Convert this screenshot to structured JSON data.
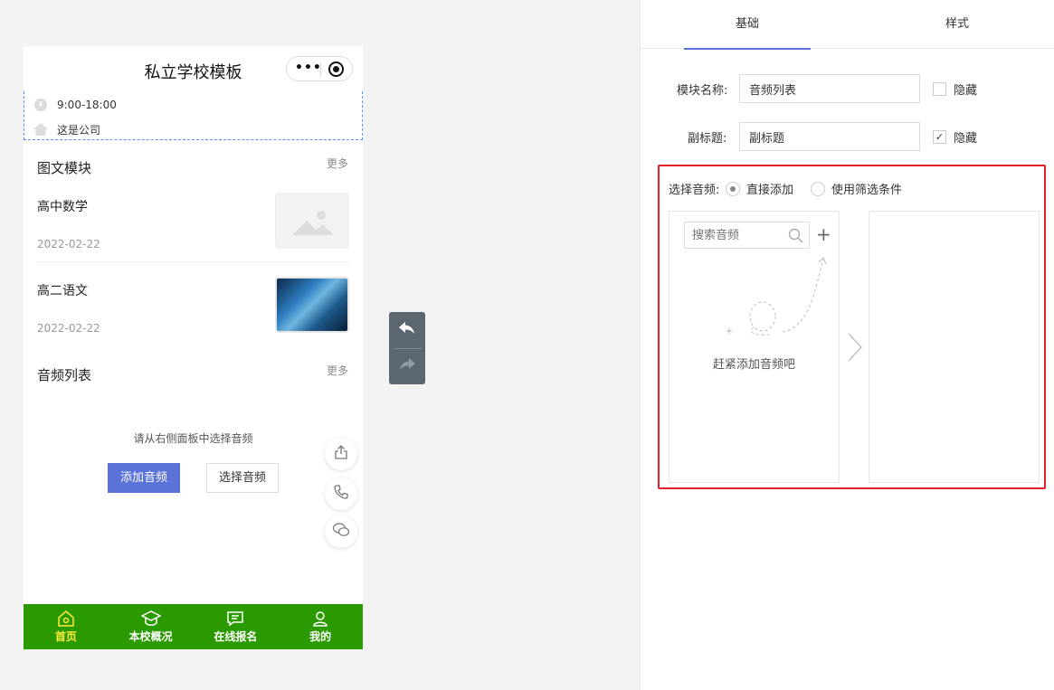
{
  "phone": {
    "title": "私立学校模板",
    "capsule_more": "•••",
    "info": {
      "hours": "9:00-18:00",
      "address": "这是公司"
    },
    "article_section": {
      "title": "图文模块",
      "more": "更多",
      "items": [
        {
          "title": "高中数学",
          "date": "2022-02-22"
        },
        {
          "title": "高二语文",
          "date": "2022-02-22"
        }
      ]
    },
    "audio_section": {
      "title": "音频列表",
      "more": "更多",
      "hint": "请从右侧面板中选择音频",
      "add_button": "添加音频",
      "select_button": "选择音频"
    },
    "tabbar": [
      {
        "label": "首页",
        "icon": "home-icon",
        "active": true
      },
      {
        "label": "本校概况",
        "icon": "graduation-cap-icon",
        "active": false
      },
      {
        "label": "在线报名",
        "icon": "message-icon",
        "active": false
      },
      {
        "label": "我的",
        "icon": "user-icon",
        "active": false
      }
    ]
  },
  "panel": {
    "tabs": [
      "基础",
      "样式"
    ],
    "active_tab": "基础",
    "module_name": {
      "label": "模块名称:",
      "value": "音频列表",
      "hide_label": "隐藏",
      "hidden": false
    },
    "subtitle": {
      "label": "副标题:",
      "value": "副标题",
      "hide_label": "隐藏",
      "hidden": true
    },
    "audio_select": {
      "label": "选择音频:",
      "options": [
        "直接添加",
        "使用筛选条件"
      ],
      "selected": "直接添加",
      "search_placeholder": "搜索音频",
      "empty_text": "赶紧添加音频吧"
    }
  },
  "colors": {
    "accent": "#5a73d8",
    "tabbar_bg": "#2b9a00",
    "tabbar_active": "#ffeb3b",
    "highlight_border": "#e0202a",
    "selection_dashed": "#5b8ff9"
  }
}
